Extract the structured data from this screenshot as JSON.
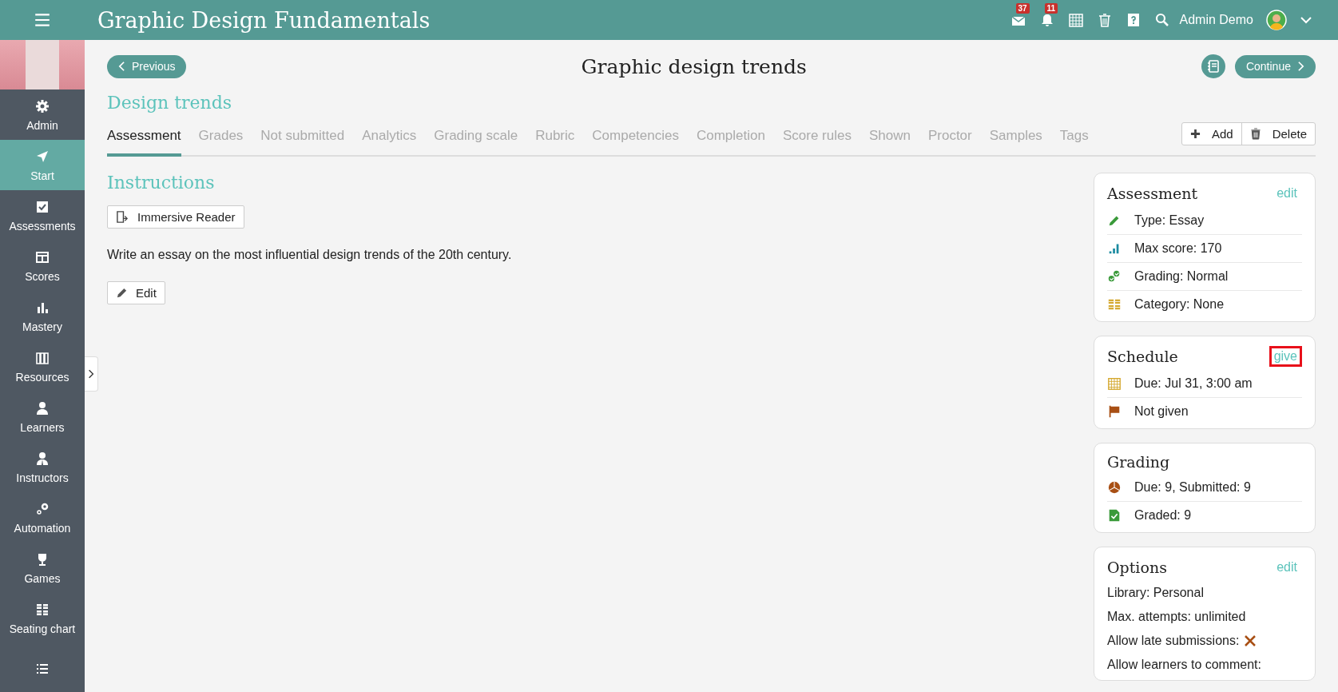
{
  "topbar": {
    "title": "Graphic Design Fundamentals",
    "icons": [
      {
        "kind": "mail",
        "badge": "37"
      },
      {
        "kind": "bell",
        "badge": "11"
      },
      {
        "kind": "calendar"
      },
      {
        "kind": "trash"
      },
      {
        "kind": "help"
      },
      {
        "kind": "search"
      }
    ],
    "user": "Admin Demo"
  },
  "sidebar": {
    "items": [
      {
        "kind": "gear",
        "label": "Admin",
        "selected": false
      },
      {
        "kind": "arrow",
        "label": "Start",
        "selected": true
      },
      {
        "kind": "check",
        "label": "Assessments",
        "selected": false
      },
      {
        "kind": "table",
        "label": "Scores",
        "selected": false
      },
      {
        "kind": "bars",
        "label": "Mastery",
        "selected": false
      },
      {
        "kind": "books",
        "label": "Resources",
        "selected": false
      },
      {
        "kind": "person",
        "label": "Learners",
        "selected": false
      },
      {
        "kind": "instructor",
        "label": "Instructors",
        "selected": false
      },
      {
        "kind": "gears",
        "label": "Automation",
        "selected": false
      },
      {
        "kind": "trophy",
        "label": "Games",
        "selected": false
      },
      {
        "kind": "seats",
        "label": "Seating chart",
        "selected": false
      },
      {
        "kind": "list",
        "selected": false
      }
    ]
  },
  "header": {
    "previous": "Previous",
    "title": "Graphic design trends",
    "continue": "Continue"
  },
  "section_title": "Design trends",
  "tabs": [
    {
      "label": "Assessment",
      "selected": true
    },
    {
      "label": "Grades",
      "selected": false
    },
    {
      "label": "Not submitted",
      "selected": false
    },
    {
      "label": "Analytics",
      "selected": false
    },
    {
      "label": "Grading scale",
      "selected": false
    },
    {
      "label": "Rubric",
      "selected": false
    },
    {
      "label": "Competencies",
      "selected": false
    },
    {
      "label": "Completion",
      "selected": false
    },
    {
      "label": "Score rules",
      "selected": false
    },
    {
      "label": "Shown",
      "selected": false
    },
    {
      "label": "Proctor",
      "selected": false
    },
    {
      "label": "Samples",
      "selected": false
    },
    {
      "label": "Tags",
      "selected": false
    }
  ],
  "actions": {
    "add": "Add",
    "delete": "Delete"
  },
  "instructions": {
    "title": "Instructions",
    "reader": "Immersive Reader",
    "text": "Write an essay on the most influential design trends of the 20th century.",
    "edit": "Edit"
  },
  "cards": [
    {
      "title": "Assessment",
      "action": "edit",
      "highlighted": false,
      "rows": [
        {
          "kind": "pencil",
          "text": "Type: Essay"
        },
        {
          "kind": "bars",
          "text": "Max score: 170"
        },
        {
          "kind": "checks",
          "text": "Grading: Normal"
        },
        {
          "kind": "grid",
          "text": "Category: None"
        }
      ]
    },
    {
      "title": "Schedule",
      "action": "give",
      "highlighted": true,
      "rows": [
        {
          "kind": "calendar",
          "text": "Due: Jul 31, 3:00 am"
        },
        {
          "kind": "flag",
          "text": "Not given"
        }
      ]
    },
    {
      "title": "Grading",
      "rows": [
        {
          "kind": "pie",
          "text": "Due: 9, Submitted: 9"
        },
        {
          "kind": "doc",
          "text": "Graded: 9"
        }
      ]
    },
    {
      "title": "Options",
      "action": "edit",
      "highlighted": false,
      "options": [
        {
          "text": "Library: Personal"
        },
        {
          "text": "Max. attempts: unlimited"
        },
        {
          "text": "Allow late submissions:",
          "allowed": false
        },
        {
          "text": "Allow learners to comment:"
        }
      ]
    }
  ]
}
